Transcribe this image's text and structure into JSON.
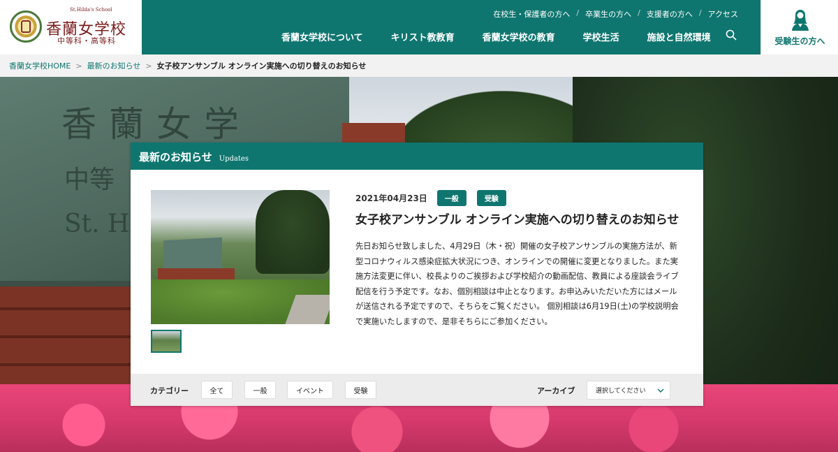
{
  "logo": {
    "en": "St.Hilda's School",
    "title": "香蘭女学校",
    "sub": "中等科・高等科"
  },
  "util_links": [
    "在校生・保護者の方へ",
    "卒業生の方へ",
    "支援者の方へ",
    "アクセス"
  ],
  "main_nav": [
    "香蘭女学校について",
    "キリスト教教育",
    "香蘭女学校の教育",
    "学校生活",
    "施設と自然環境"
  ],
  "applicant": {
    "label": "受験生の方へ"
  },
  "breadcrumb": {
    "home": "香蘭女学校HOME",
    "section": "最新のお知らせ",
    "current": "女子校アンサンブル オンライン実施への切り替えのお知らせ"
  },
  "hero_sign": {
    "line1": "香蘭女学",
    "line2": "中等",
    "line3": "St. Hi"
  },
  "card": {
    "title": "最新のお知らせ",
    "title_en": "Updates"
  },
  "post": {
    "date": "2021年04月23日",
    "badges": [
      "一般",
      "受験"
    ],
    "title": "女子校アンサンブル オンライン実施への切り替えのお知らせ",
    "body": "先日お知らせ致しました、4月29日（木・祝）開催の女子校アンサンブルの実施方法が、新型コロナウィルス感染症拡大状況につき、オンラインでの開催に変更となりました。また実施方法変更に伴い、校長よりのご挨拶および学校紹介の動画配信、教員による座談会ライブ配信を行う予定です。なお、個別相談は中止となります。お申込みいただいた方にはメールが送信される予定ですので、そちらをご覧ください。 個別相談は6月19日(土)の学校説明会で実施いたしますので、是非そちらにご参加ください。"
  },
  "footer": {
    "category_label": "カテゴリー",
    "categories": [
      "全て",
      "一般",
      "イベント",
      "受験"
    ],
    "archive_label": "アーカイブ",
    "archive_select": "選択してください"
  },
  "colors": {
    "brand": "#0f766f",
    "logo": "#7a1d1d"
  }
}
